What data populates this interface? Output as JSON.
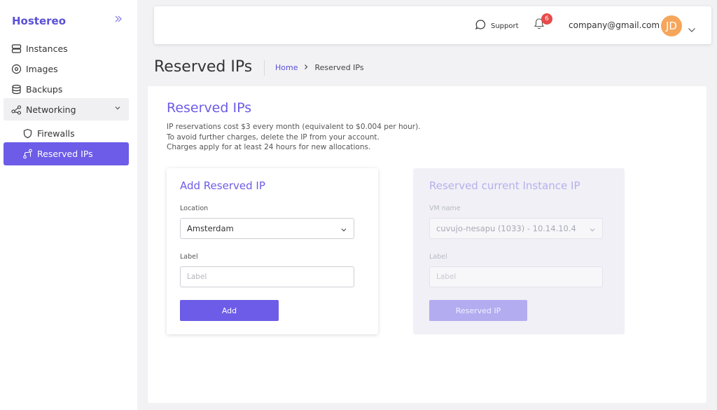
{
  "sidebar": {
    "brand": "Hostereo",
    "collapse_icon": "double-chevron-right-icon",
    "items": [
      {
        "label": "Instances",
        "icon": "server-icon"
      },
      {
        "label": "Images",
        "icon": "disc-icon"
      },
      {
        "label": "Backups",
        "icon": "database-icon"
      },
      {
        "label": "Networking",
        "icon": "share-icon"
      },
      {
        "label": "Firewalls",
        "icon": "shield-icon"
      },
      {
        "label": "Reserved IPs",
        "icon": "route-icon"
      }
    ]
  },
  "topbar": {
    "support_label": "Support",
    "notification_count": "6",
    "email": "company@gmail.com",
    "avatar_initials": "JD"
  },
  "page": {
    "title": "Reserved IPs",
    "breadcrumb_home": "Home",
    "breadcrumb_current": "Reserved IPs"
  },
  "panel": {
    "title": "Reserved IPs",
    "description": [
      "IP reservations cost $3 every month (equivalent to $0.004 per hour).",
      "To avoid further charges, delete the IP from your account.",
      "Charges apply for at least 24 hours for new allocations."
    ]
  },
  "add_card": {
    "title": "Add Reserved IP",
    "location_label": "Location",
    "location_value": "Amsterdam",
    "label_label": "Label",
    "label_placeholder": "Label",
    "button": "Add"
  },
  "reserve_card": {
    "title": "Reserved current Instance IP",
    "vm_label": "VM name",
    "vm_value": "cuvujo-nesapu (1033) - 10.14.10.4",
    "label_label": "Label",
    "label_placeholder": "Label",
    "button": "Reserved IP"
  },
  "colors": {
    "accent": "#6c5ce7",
    "badge": "#e84a4a",
    "avatar": "#f5a65b"
  }
}
